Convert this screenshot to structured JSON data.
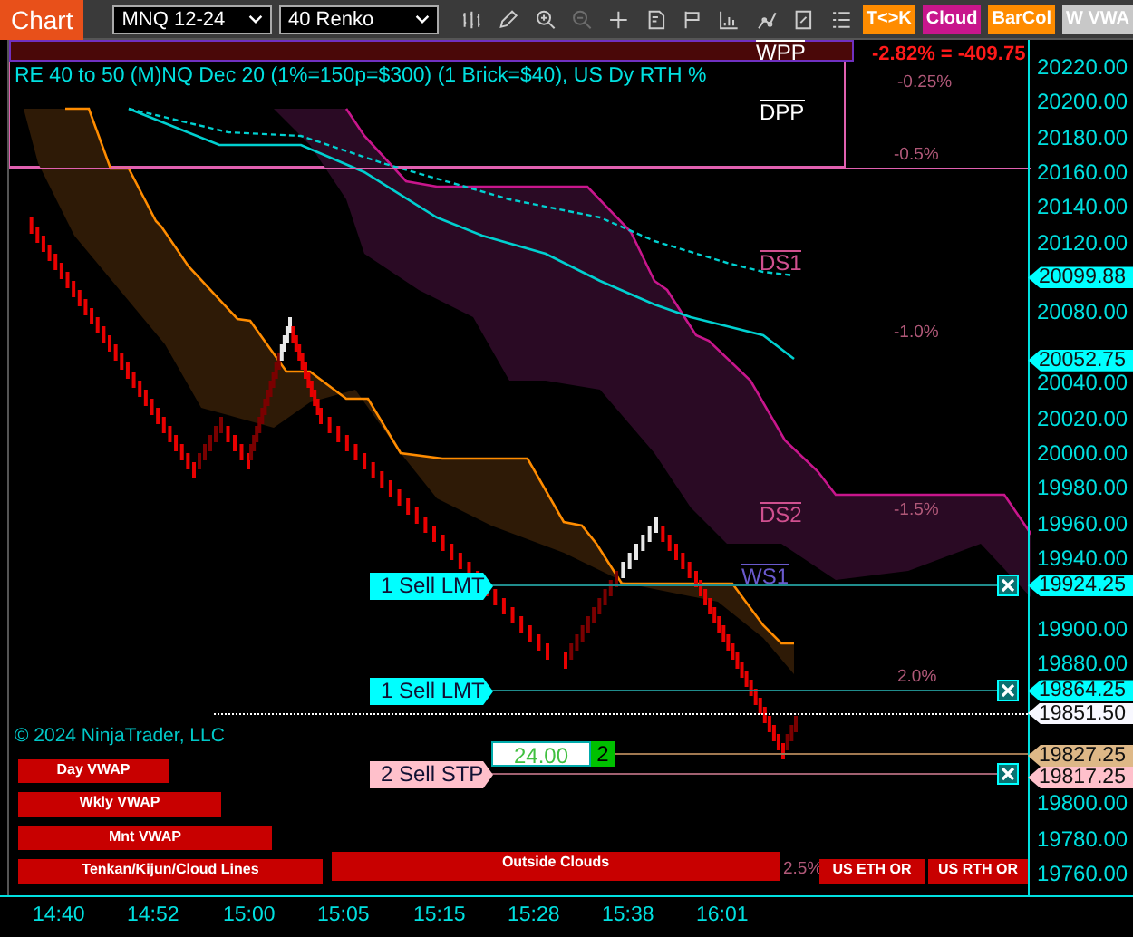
{
  "toolbar": {
    "chart_button": "Chart",
    "instrument": "MNQ 12-24",
    "bar_type": "40 Renko",
    "tools": [
      {
        "kind": "bars",
        "disabled": false
      },
      {
        "kind": "pencil",
        "disabled": false
      },
      {
        "kind": "zoom-in",
        "disabled": false
      },
      {
        "kind": "zoom-out",
        "disabled": true
      },
      {
        "kind": "crosshair",
        "disabled": false
      },
      {
        "kind": "data-box",
        "disabled": false
      },
      {
        "kind": "flag",
        "disabled": false
      },
      {
        "kind": "columns",
        "disabled": false
      },
      {
        "kind": "line",
        "disabled": false
      },
      {
        "kind": "frame",
        "disabled": false
      },
      {
        "kind": "list",
        "disabled": false
      }
    ],
    "toggles": [
      {
        "label": "T<>K",
        "color": "#ff8c00"
      },
      {
        "label": "Cloud",
        "color": "#c8168c"
      },
      {
        "label": "BarCol",
        "color": "#ff8c00"
      },
      {
        "label": "W VWA",
        "color": "#c8c8c8"
      }
    ]
  },
  "chart": {
    "title": "RE 40 to 50 (M)NQ Dec 20 (1%=150p=$300) (1 Brick=$40), US Dy RTH %",
    "pnl": "-2.82% = -409.75",
    "pivots": [
      {
        "label": "WPP",
        "color": "#ffffff"
      },
      {
        "label": "DPP",
        "color": "#ffffff"
      },
      {
        "label": "DS1",
        "color": "#d0508f"
      },
      {
        "label": "DS2",
        "color": "#d0508f"
      },
      {
        "label": "WS1",
        "color": "#6a5acd"
      }
    ],
    "percent_levels": [
      "-0.25%",
      "-0.5%",
      "-1.0%",
      "-1.5%",
      "2.0%",
      "2.5%"
    ],
    "orders": [
      {
        "label": "1 Sell LMT",
        "kind": "limit"
      },
      {
        "label": "1 Sell LMT",
        "kind": "limit"
      },
      {
        "label": "2 Sell STP",
        "kind": "stop"
      }
    ],
    "quantity": "24.00",
    "quantity_count": "2",
    "legend_bars": [
      "Day VWAP",
      "Wkly VWAP",
      "Mnt VWAP",
      "Tenkan/Kijun/Cloud Lines",
      "Outside Clouds",
      "US ETH OR",
      "US RTH OR"
    ],
    "copyright": "© 2024 NinjaTrader, LLC"
  },
  "price_axis": {
    "ticks": [
      "20220.00",
      "20200.00",
      "20180.00",
      "20160.00",
      "20140.00",
      "20120.00",
      "20080.00",
      "20040.00",
      "20020.00",
      "20000.00",
      "19980.00",
      "19960.00",
      "19940.00",
      "19900.00",
      "19880.00",
      "19800.00",
      "19780.00",
      "19760.00"
    ],
    "markers": [
      {
        "label": "20099.88",
        "color": "#00ffff"
      },
      {
        "label": "20052.75",
        "color": "#00ffff"
      },
      {
        "label": "19924.25",
        "color": "#00ffff"
      },
      {
        "label": "19864.25",
        "color": "#00ffff"
      },
      {
        "label": "19851.50",
        "color": "#f8f8ff"
      },
      {
        "label": "19827.25",
        "color": "#deb887"
      },
      {
        "label": "19817.25",
        "color": "#ffc0cb"
      }
    ]
  },
  "time_axis": [
    "14:40",
    "14:52",
    "15:00",
    "15:05",
    "15:15",
    "15:28",
    "15:38",
    "16:01"
  ]
}
